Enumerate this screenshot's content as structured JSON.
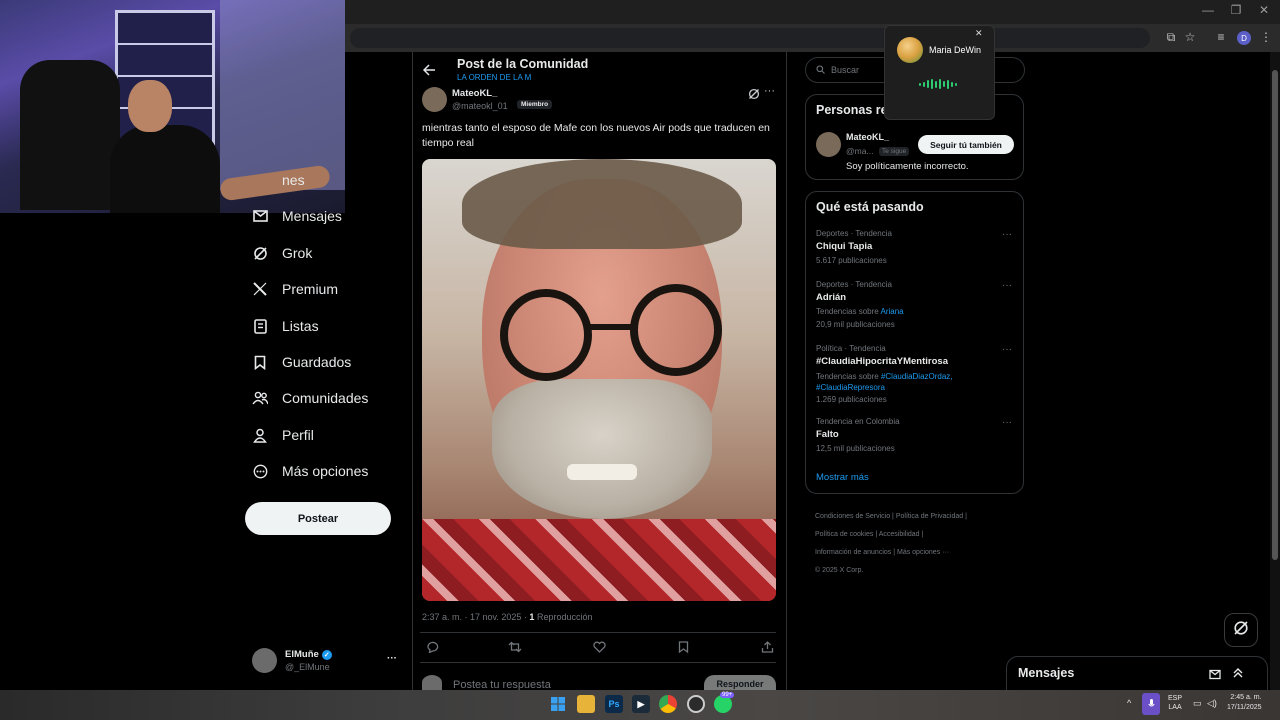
{
  "window": {
    "minimize": "—",
    "restore": "❐",
    "close": "✕"
  },
  "browser": {
    "profile_initial": "D"
  },
  "sidebar": {
    "items": [
      {
        "label": "nes",
        "icon": "bell-icon"
      },
      {
        "label": "Mensajes",
        "icon": "mail-icon"
      },
      {
        "label": "Grok",
        "icon": "grok-icon"
      },
      {
        "label": "Premium",
        "icon": "x-logo-icon"
      },
      {
        "label": "Listas",
        "icon": "list-icon"
      },
      {
        "label": "Guardados",
        "icon": "bookmark-icon"
      },
      {
        "label": "Comunidades",
        "icon": "people-icon"
      },
      {
        "label": "Perfil",
        "icon": "person-icon"
      },
      {
        "label": "Más opciones",
        "icon": "more-circle-icon"
      }
    ],
    "post_button": "Postear",
    "account": {
      "name": "ElMuñe",
      "handle": "@_ElMune",
      "verified": true,
      "more": "···"
    }
  },
  "header": {
    "title": "Post de la Comunidad",
    "subtitle": "LA ORDEN DE LA M"
  },
  "post": {
    "author_name": "MateoKL_",
    "author_handle": "@mateokl_01",
    "member_badge": "Miembro",
    "text": "mientras tanto el esposo de Mafe con los nuevos Air pods que traducen en tiempo real",
    "time": "2:37 a. m. · 17 nov. 2025 ·",
    "views_count": "1",
    "views_label": "Reproducción",
    "reply_placeholder": "Postea tu respuesta",
    "reply_button": "Responder"
  },
  "right": {
    "search_placeholder": "Buscar",
    "who_to_follow": {
      "title": "Personas re",
      "name": "MateoKL_",
      "handle": "@ma...",
      "follows_you": "Te sigue",
      "follow_button": "Seguir tú también",
      "bio": "Soy políticamente incorrecto."
    },
    "trends": {
      "title": "Qué está pasando",
      "items": [
        {
          "context": "Deportes · Tendencia",
          "name": "Chiqui Tapia",
          "related_prefix": "",
          "related": "",
          "count": "5.617 publicaciones"
        },
        {
          "context": "Deportes · Tendencia",
          "name": "Adrián",
          "related_prefix": "Tendencias sobre ",
          "related": "Ariana",
          "count": "20,9 mil publicaciones"
        },
        {
          "context": "Política · Tendencia",
          "name": "#ClaudiaHipocritaYMentirosa",
          "related_prefix": "Tendencias sobre ",
          "related": "#ClaudiaDiazOrdaz, #ClaudiaRepresora",
          "count": "1.269 publicaciones"
        },
        {
          "context": "Tendencia en Colombia",
          "name": "Falto",
          "related_prefix": "",
          "related": "",
          "count": "12,5 mil publicaciones"
        }
      ],
      "show_more": "Mostrar más"
    },
    "footer": {
      "links": [
        "Condiciones de Servicio",
        "Política de Privacidad",
        "Política de cookies",
        "Accesibilidad",
        "Información de anuncios",
        "Más opciones ···"
      ],
      "copyright": "© 2025 X Corp."
    }
  },
  "popup": {
    "name": "Maria DeWin",
    "close": "✕"
  },
  "messages": {
    "title": "Mensajes"
  },
  "taskbar": {
    "ps_label": "Ps",
    "badge": "99+",
    "lang1": "ESP",
    "lang2": "LAA",
    "time": "2:45 a. m.",
    "date": "17/11/2025"
  },
  "colors": {
    "accent": "#1d9bf0",
    "background": "#000000",
    "text": "#e7e9ea",
    "muted": "#71767b",
    "border": "#2f3336"
  }
}
